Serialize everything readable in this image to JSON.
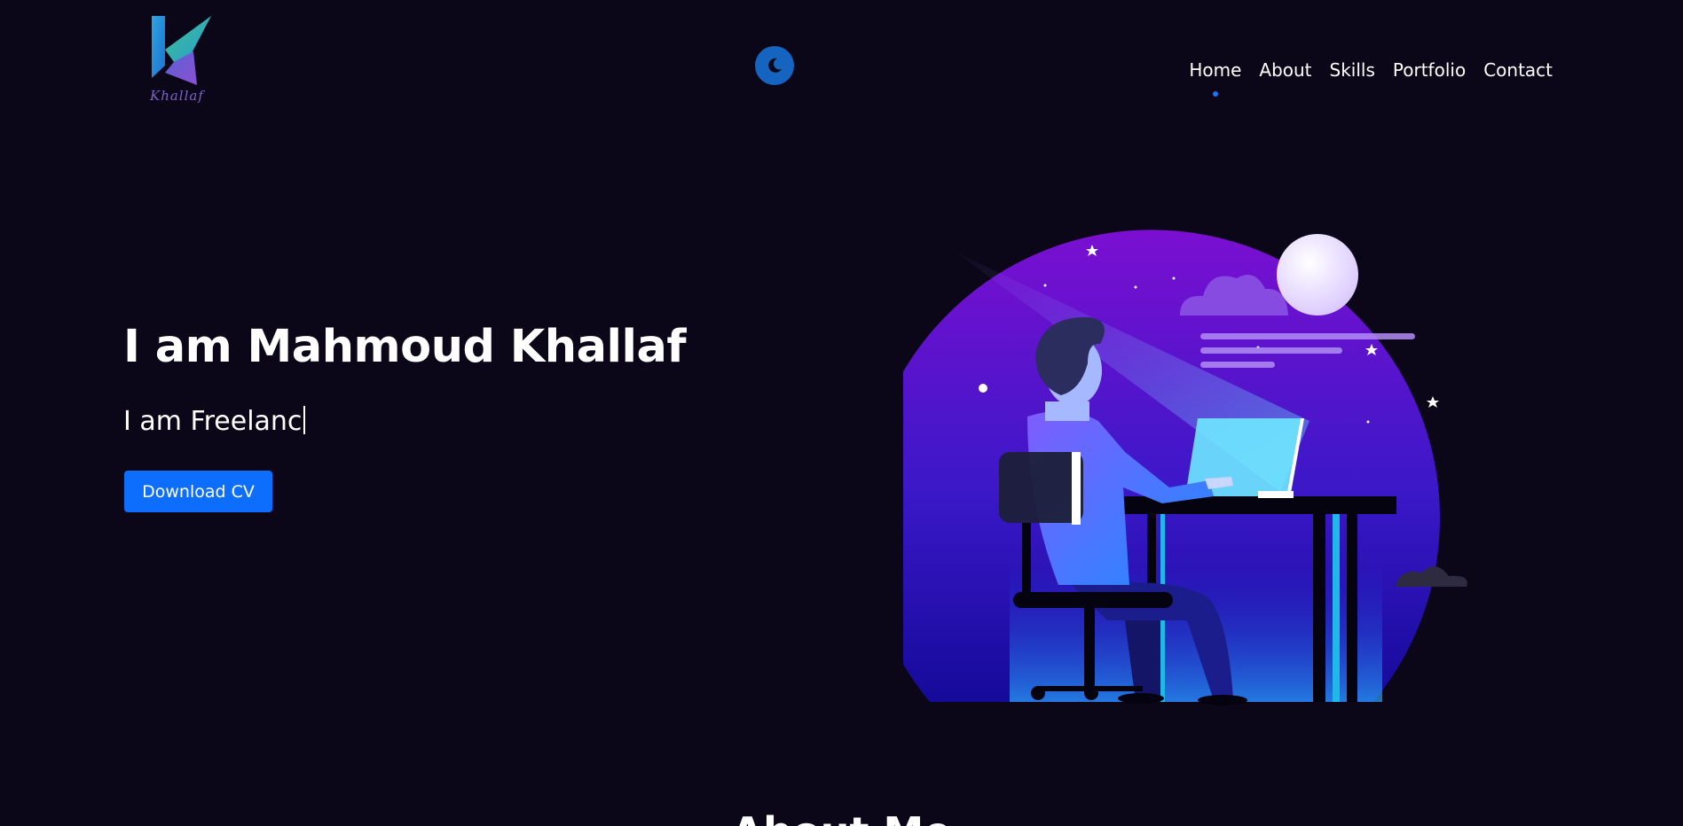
{
  "header": {
    "logo_text": "Khallaf",
    "nav": [
      {
        "label": "Home",
        "active": true
      },
      {
        "label": "About",
        "active": false
      },
      {
        "label": "Skills",
        "active": false
      },
      {
        "label": "Portfolio",
        "active": false
      },
      {
        "label": "Contact",
        "active": false
      }
    ],
    "theme_icon": "moon-icon"
  },
  "hero": {
    "title": "I am Mahmoud Khallaf",
    "typed_text": "I am Freelanc",
    "cta_label": "Download CV"
  },
  "about": {
    "heading": "About Me"
  },
  "colors": {
    "background": "#0b0719",
    "accent": "#0d6efd",
    "toggle": "#1565c0"
  }
}
